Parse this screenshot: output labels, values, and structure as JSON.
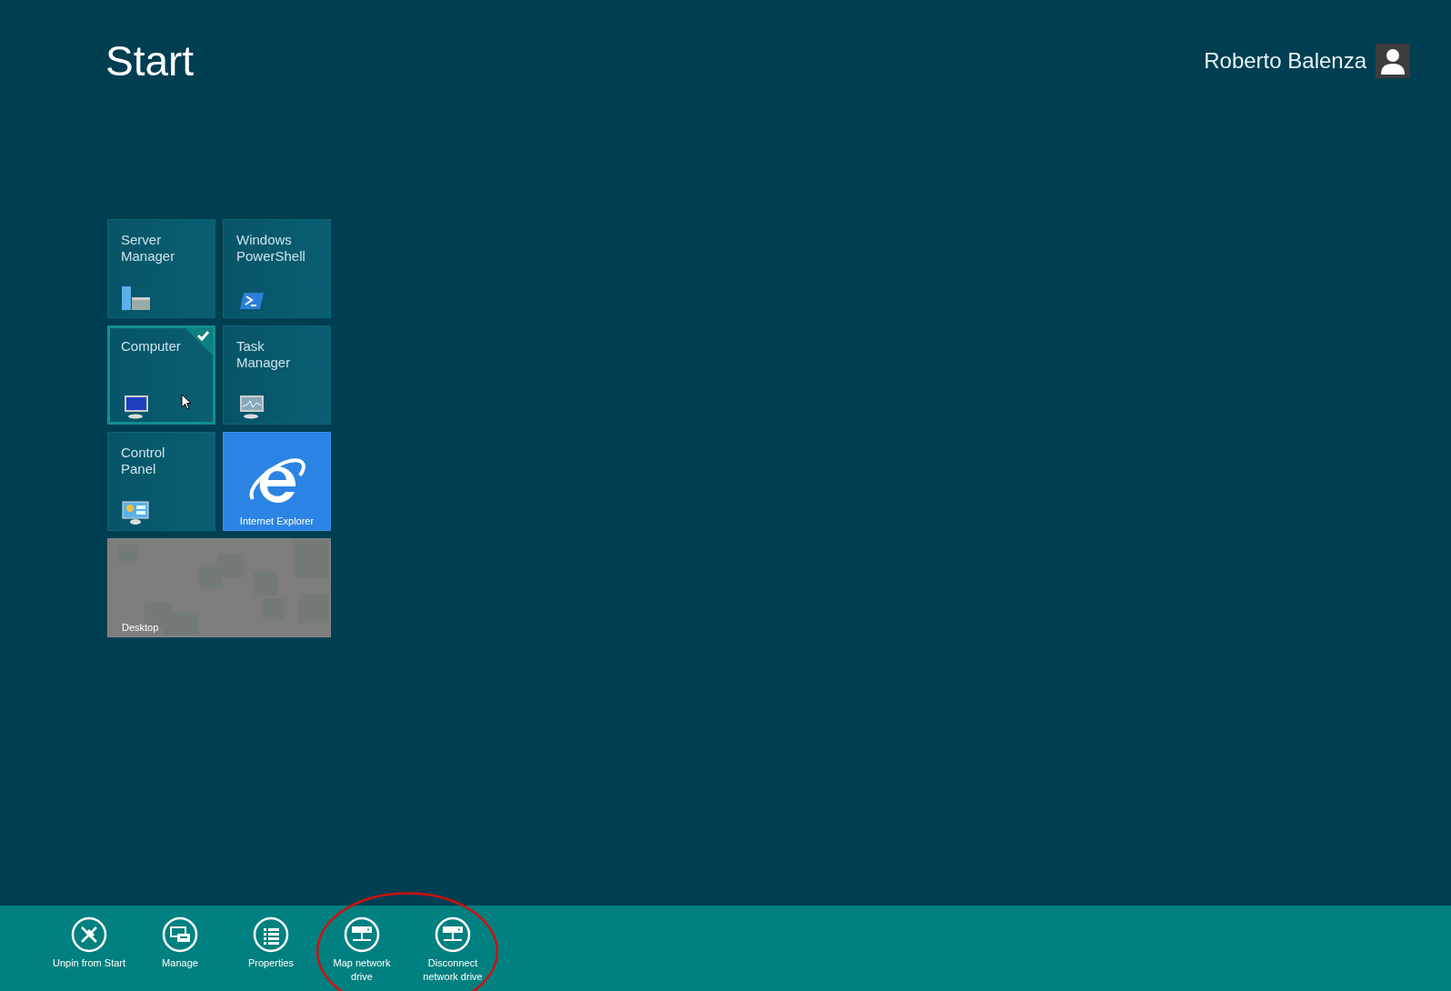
{
  "header": {
    "title": "Start",
    "user_name": "Roberto Balenza"
  },
  "tiles": [
    {
      "kind": "app",
      "label": "Server Manager",
      "selected": false
    },
    {
      "kind": "app",
      "label": "Windows PowerShell",
      "selected": false
    },
    {
      "kind": "app",
      "label": "Computer",
      "selected": true
    },
    {
      "kind": "app",
      "label": "Task Manager",
      "selected": false
    },
    {
      "kind": "app",
      "label": "Control Panel",
      "selected": false
    },
    {
      "kind": "browser",
      "label": "Internet Explorer",
      "selected": false
    },
    {
      "kind": "desktop",
      "label": "Desktop",
      "selected": false
    }
  ],
  "app_bar": {
    "commands": [
      {
        "label": "Unpin from Start",
        "circled": false
      },
      {
        "label": "Manage",
        "circled": false
      },
      {
        "label": "Properties",
        "circled": false
      },
      {
        "label": "Map network drive",
        "circled": true
      },
      {
        "label": "Disconnect network drive",
        "circled": true
      }
    ]
  }
}
